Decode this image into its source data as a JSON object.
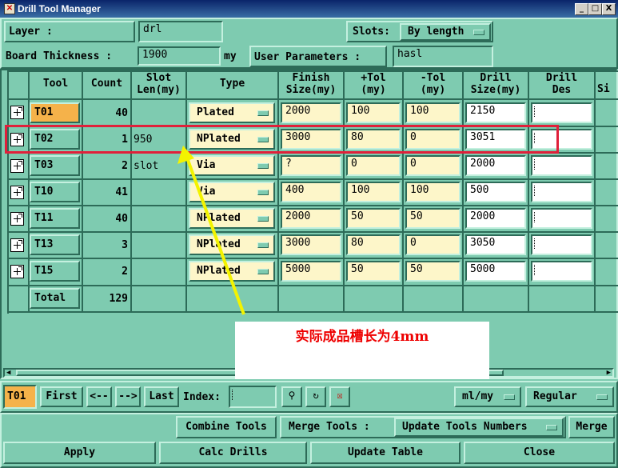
{
  "window": {
    "title": "Drill Tool Manager",
    "minimize": "_",
    "maximize": "□",
    "close": "X"
  },
  "top": {
    "layer_label": "Layer      :",
    "layer_value": "drl",
    "slots_label": "Slots:",
    "slots_value": "By length",
    "board_thickness_label": "Board Thickness :",
    "board_thickness_value": "1900",
    "board_thickness_unit": "my",
    "user_params_label": "User Parameters :",
    "user_params_value": "hasl"
  },
  "table": {
    "headers": {
      "tool": "Tool",
      "count": "Count",
      "slot_len_1": "Slot",
      "slot_len_2": "Len(my)",
      "type": "Type",
      "finish_1": "Finish",
      "finish_2": "Size(my)",
      "ptol_1": "+Tol",
      "ptol_2": "(my)",
      "mtol_1": "-Tol",
      "mtol_2": "(my)",
      "drill_1": "Drill",
      "drill_2": "Size(my)",
      "drilldes_1": "Drill",
      "drilldes_2": "Des",
      "si": "Si"
    },
    "rows": [
      {
        "tool": "T01",
        "count": "40",
        "slot_len": "",
        "type": "Plated",
        "finish": "2000",
        "ptol": "100",
        "mtol": "100",
        "drill": "2150",
        "des": ""
      },
      {
        "tool": "T02",
        "count": "1",
        "slot_len": "950",
        "type": "NPlated",
        "finish": "3000",
        "ptol": "80",
        "mtol": "0",
        "drill": "3051",
        "des": ""
      },
      {
        "tool": "T03",
        "count": "2",
        "slot_len": "slot",
        "type": "Via",
        "finish": "?",
        "ptol": "0",
        "mtol": "0",
        "drill": "2000",
        "des": ""
      },
      {
        "tool": "T10",
        "count": "41",
        "slot_len": "",
        "type": "Via",
        "finish": "400",
        "ptol": "100",
        "mtol": "100",
        "drill": "500",
        "des": ""
      },
      {
        "tool": "T11",
        "count": "40",
        "slot_len": "",
        "type": "NPlated",
        "finish": "2000",
        "ptol": "50",
        "mtol": "50",
        "drill": "2000",
        "des": ""
      },
      {
        "tool": "T13",
        "count": "3",
        "slot_len": "",
        "type": "NPlated",
        "finish": "3000",
        "ptol": "80",
        "mtol": "0",
        "drill": "3050",
        "des": ""
      },
      {
        "tool": "T15",
        "count": "2",
        "slot_len": "",
        "type": "NPlated",
        "finish": "5000",
        "ptol": "50",
        "mtol": "50",
        "drill": "5000",
        "des": ""
      }
    ],
    "total_label": "Total",
    "total_count": "129"
  },
  "annotation": {
    "text": "实际成品槽长为4mm",
    "highlight_color": "#e0203a",
    "arrow_color": "#f3f300"
  },
  "nav": {
    "current_tool": "T01",
    "first": "First",
    "prev": "<--",
    "next": "-->",
    "last": "Last",
    "index_label": "Index:",
    "index_value": "",
    "unit_value": "ml/my",
    "mode_value": "Regular"
  },
  "actions": {
    "combine": "Combine Tools",
    "merge_tools_label": "Merge Tools :",
    "merge_tools_value": "Update Tools Numbers",
    "merge": "Merge",
    "apply": "Apply",
    "calc": "Calc Drills",
    "update": "Update Table",
    "close": "Close"
  },
  "colors": {
    "background": "#7ecbb0",
    "input_yellow": "#fdf6c9",
    "selected_tool": "#f5b24a"
  }
}
